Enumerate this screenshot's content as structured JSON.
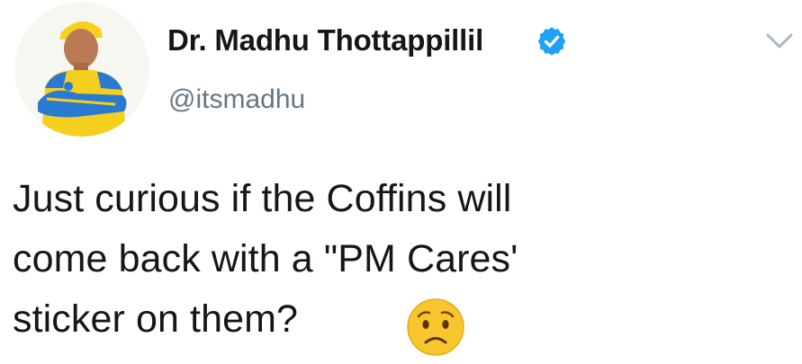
{
  "user": {
    "display_name": "Dr. Madhu Thottappillil",
    "handle": "@itsmadhu",
    "verified": true,
    "avatar_icon": "profile-photo-yellow-jersey"
  },
  "tweet": {
    "text": "Just curious if the Coffins will\ncome back with a \"PM Cares'\nsticker on them?",
    "emoji": "worried-face"
  },
  "icons": {
    "verified": "verified-badge-icon",
    "menu": "chevron-down-icon"
  },
  "colors": {
    "verified_blue": "#1da1f2",
    "handle_gray": "#657786",
    "text_dark": "#14171a",
    "chevron_gray": "#aab8c2",
    "emoji_yellow": "#f7c62f",
    "jersey_yellow": "#f5cf1d",
    "jersey_blue": "#2a7ad1"
  }
}
